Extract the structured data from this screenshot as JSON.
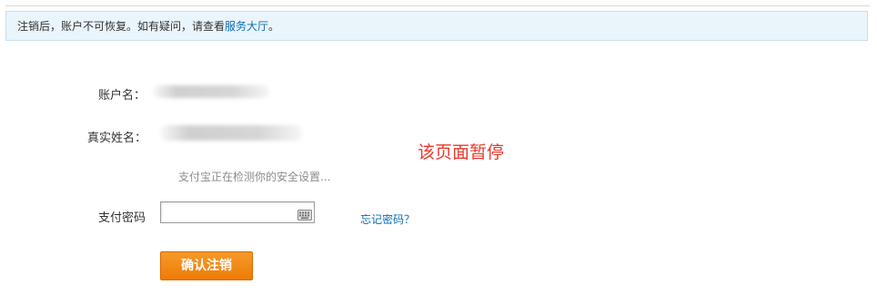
{
  "notice": {
    "text": "注销后，账户不可恢复。如有疑问，请查看",
    "link": "服务大厅",
    "end": "。"
  },
  "form": {
    "account_label": "账户名：",
    "realname_label": "真实姓名：",
    "checking_text": "支付宝正在检测你的安全设置...",
    "password_label": "支付密码",
    "password_value": "",
    "forgot_link": "忘记密码？",
    "confirm_label": "确认注销"
  },
  "overlay": {
    "paused_text": "该页面暂停"
  },
  "icons": {
    "keyboard": "keyboard-icon"
  },
  "colors": {
    "notice_bg": "#eaf4fb",
    "link": "#0a6fb5",
    "paused": "#e8392f",
    "button": "#ee7b06"
  }
}
